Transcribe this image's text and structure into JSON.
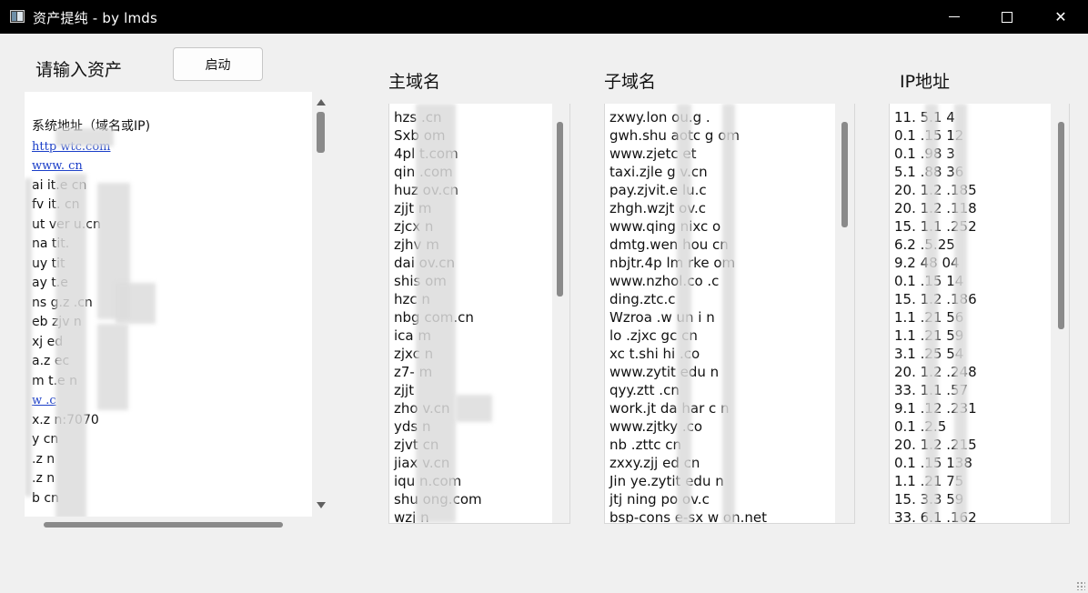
{
  "window": {
    "title": "资产提纯 - by lmds",
    "minimize_glyph": "",
    "maximize_glyph": "",
    "close_glyph": "✕"
  },
  "input": {
    "label": "请输入资产",
    "start_label": "启动",
    "lines": [
      {
        "text": "系统地址（域名或IP)",
        "link": false
      },
      {
        "text": "http        wtc.com",
        "link": true
      },
      {
        "text": "www.          cn",
        "link": true
      },
      {
        "text": "ai       it.e    cn",
        "link": false
      },
      {
        "text": "fv      it.    cn",
        "link": false
      },
      {
        "text": "ut      ver         u.cn",
        "link": false
      },
      {
        "text": "na      tit.",
        "link": false
      },
      {
        "text": "uy      tit",
        "link": false
      },
      {
        "text": "ay      t.e",
        "link": false
      },
      {
        "text": "ns      g.z           .cn",
        "link": false
      },
      {
        "text": "eb       zjv          n",
        "link": false
      },
      {
        "text": "xj       ed",
        "link": false
      },
      {
        "text": "a.z      ec",
        "link": false
      },
      {
        "text": "m        t.e     n",
        "link": false
      },
      {
        "text": "w       .c",
        "link": true
      },
      {
        "text": "x.z      n:7070",
        "link": false
      },
      {
        "text": "y       cn",
        "link": false
      },
      {
        "text": ".z       n",
        "link": false
      },
      {
        "text": ".z       n",
        "link": false
      },
      {
        "text": "b        cn",
        "link": false
      }
    ]
  },
  "domains": {
    "label": "主域名",
    "items": [
      "hzs        .cn",
      "Sxb        om",
      "4pl          t.com",
      "qin          .com",
      "huz          ov.cn",
      "zjjt         m",
      "zjcx         n",
      "zjhv         m",
      "dai          ov.cn",
      "shis         om",
      "hzc          n",
      "nbg          com.cn",
      "ica          m",
      "zjxc         n",
      "z7-          m",
      "zjjt",
      "zho                 v.cn",
      "yds          n",
      "zjvt         cn",
      "jiax         v.cn",
      "iqu          n.com",
      "shu          ong.com",
      "wzj          n"
    ]
  },
  "subdomains": {
    "label": "子域名",
    "items": [
      "zxwy.lon   ou.g   .",
      "gwh.shu    aotc   g   om",
      "www.zjetc   et",
      "taxi.zjle   g   v.cn",
      "pay.zjvit.e  lu.c",
      "zhgh.wzjt   ov.c",
      "www.qing   nixc   o",
      "dmtg.wen    hou    cn",
      "nbjtr.4p   lm   rke   om",
      "www.nzhol.co   .c",
      "ding.ztc.c",
      "Wzroa    .w    un   i   n",
      "lo   .zjxc   gc   cn",
      "xc   t.shi   hi   .co",
      "www.zytit   edu   n",
      "qyy.ztt   .cn",
      "work.jt   da   har   c   n",
      "www.zjtky   .co",
      "nb   .zttc   cn",
      "zxxy.zjj   ed   cn",
      "Jin   ye.zytit   edu   n",
      "jtj   ning   po   ov.c",
      "bsp-cons   e-sx   w   on.net"
    ]
  },
  "ips": {
    "label": "IP地址",
    "items": [
      "11.   5.1   4",
      "0.1   .15   12",
      "0.1   .98   3",
      "5.1   .88   36",
      "20.   1.2   .185",
      "20.   1.2   .118",
      "15.   1.1   .252",
      "6.2   .5.25",
      "9.2   48   04",
      "0.1   .15   14",
      "15.   1.2   .186",
      "1.1   .21   56",
      "1.1   .21   59",
      "3.1   .25   54",
      "20.   1.2   .248",
      "33.   1.1   .57",
      "9.1   .12   .231",
      "0.1   .2.5",
      "20.   1.2   .215",
      "0.1   .15   138",
      "1.1   .21   75",
      "15.   3.3   59",
      "33.   6.1   .162"
    ]
  }
}
